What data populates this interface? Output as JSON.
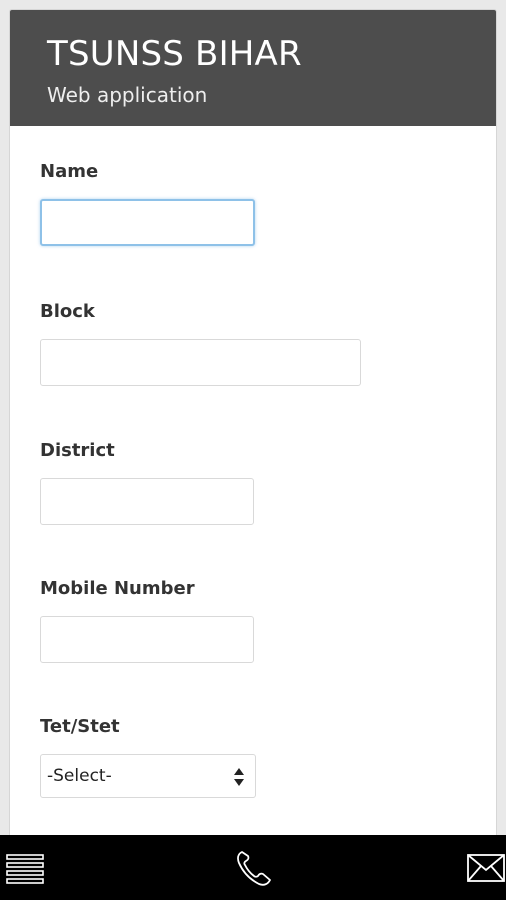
{
  "header": {
    "title": "TSUNSS BIHAR",
    "subtitle": "Web application"
  },
  "form": {
    "fields": [
      {
        "label": "Name",
        "value": "",
        "focused": true
      },
      {
        "label": "Block",
        "value": ""
      },
      {
        "label": "District",
        "value": ""
      },
      {
        "label": "Mobile Number",
        "value": ""
      }
    ],
    "select": {
      "label": "Tet/Stet",
      "selected": "-Select-"
    }
  },
  "bottom_bar": {
    "icons": [
      "menu-icon",
      "phone-icon",
      "mail-icon"
    ]
  },
  "colors": {
    "header_bg": "#4d4d4d",
    "bottom_bar_bg": "#000000",
    "focus_border": "#8ec1e8"
  }
}
